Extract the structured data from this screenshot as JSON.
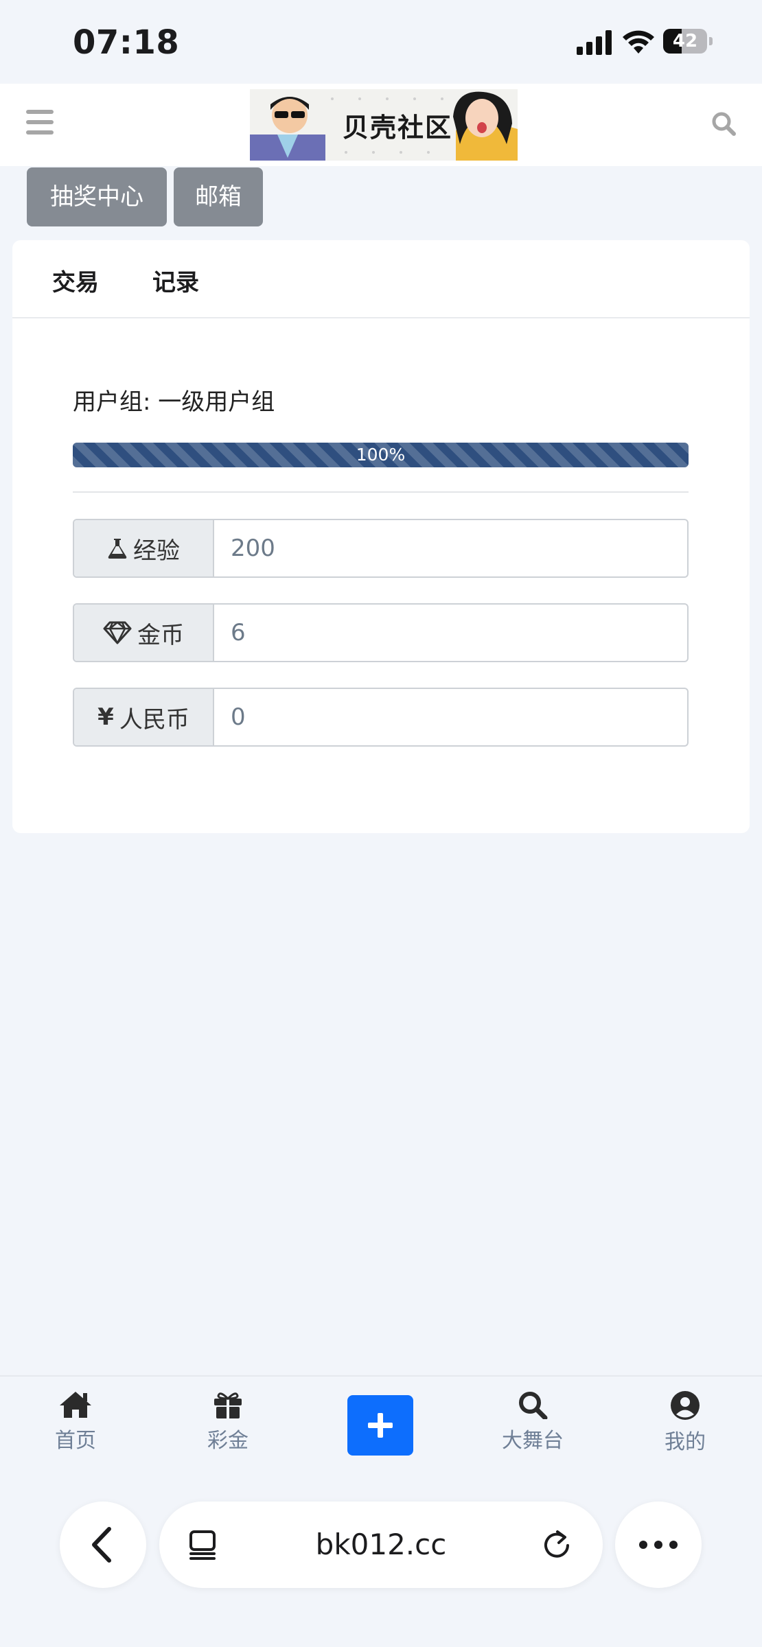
{
  "status_bar": {
    "time": "07:18",
    "battery": "42",
    "battery_level": 0.42
  },
  "header": {
    "logo_text": "贝壳社区",
    "menu_icon": "hamburger-menu-icon",
    "search_icon": "search-icon"
  },
  "top_tabs": [
    {
      "label": "抽奖中心"
    },
    {
      "label": "邮箱"
    }
  ],
  "card": {
    "tabs": [
      {
        "label": "交易"
      },
      {
        "label": "记录"
      }
    ],
    "user_group": "用户组: 一级用户组",
    "progress": {
      "text": "100%",
      "value": 1.0
    },
    "fields": [
      {
        "icon": "flask-icon",
        "label": "经验",
        "value": "200"
      },
      {
        "icon": "diamond-icon",
        "label": "金币",
        "value": "6"
      },
      {
        "icon": "yen-icon",
        "icon_glyph": "¥",
        "label": "人民币",
        "value": "0"
      }
    ]
  },
  "bottom_nav": {
    "items": [
      {
        "icon": "home-icon",
        "label": "首页"
      },
      {
        "icon": "gift-icon",
        "label": "彩金"
      },
      {
        "icon": "plus-icon",
        "label": ""
      },
      {
        "icon": "search-icon",
        "label": "大舞台"
      },
      {
        "icon": "user-circle-icon",
        "label": "我的"
      }
    ]
  },
  "browser": {
    "url": "bk012.cc",
    "back_icon": "chevron-left-icon",
    "tabs_icon": "tabs-icon",
    "reload_icon": "reload-icon",
    "more_icon": "more-icon"
  },
  "colors": {
    "accent": "#0d6efd",
    "progress": "#2f4f7f",
    "tab_button": "#858b93",
    "background": "#f2f5fa"
  }
}
